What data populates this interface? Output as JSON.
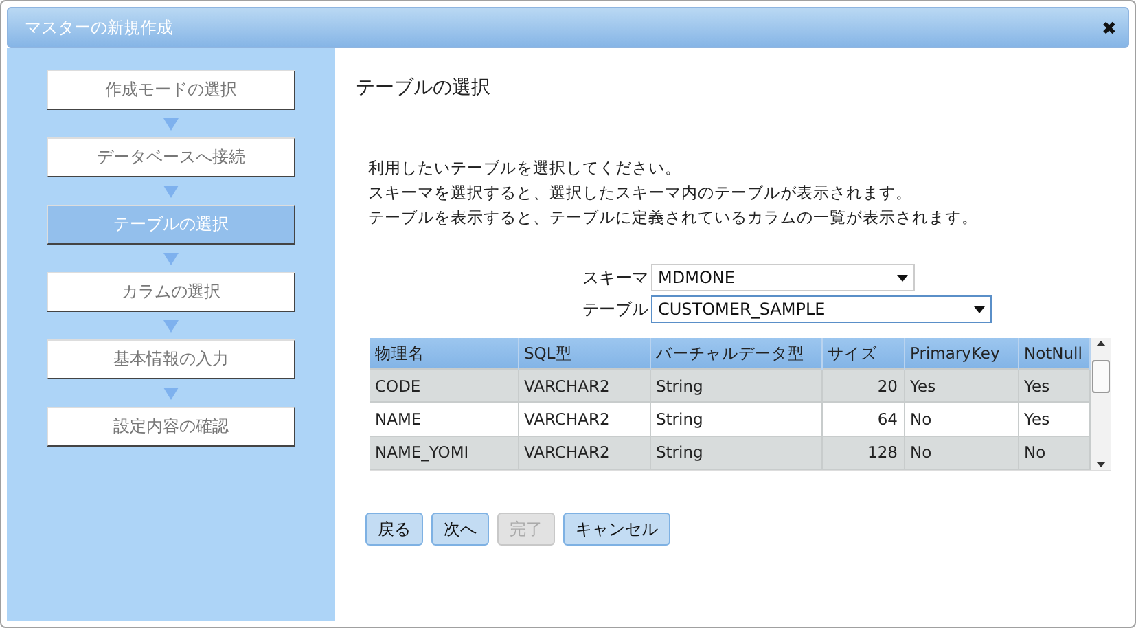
{
  "window": {
    "title": "マスターの新規作成",
    "close": "✖"
  },
  "steps": [
    {
      "label": "作成モードの選択",
      "selected": false
    },
    {
      "label": "データベースへ接続",
      "selected": false
    },
    {
      "label": "テーブルの選択",
      "selected": true
    },
    {
      "label": "カラムの選択",
      "selected": false
    },
    {
      "label": "基本情報の入力",
      "selected": false
    },
    {
      "label": "設定内容の確認",
      "selected": false
    }
  ],
  "heading": "テーブルの選択",
  "instructions": [
    "利用したいテーブルを選択してください。",
    "スキーマを選択すると、選択したスキーマ内のテーブルが表示されます。",
    "テーブルを表示すると、テーブルに定義されているカラムの一覧が表示されます。"
  ],
  "schema": {
    "label": "スキーマ",
    "value": "MDMONE"
  },
  "table_select": {
    "label": "テーブル",
    "value": "CUSTOMER_SAMPLE"
  },
  "table": {
    "columns": [
      "物理名",
      "SQL型",
      "バーチャルデータ型",
      "サイズ",
      "PrimaryKey",
      "NotNull"
    ],
    "rows": [
      [
        "CODE",
        "VARCHAR2",
        "String",
        "20",
        "Yes",
        "Yes"
      ],
      [
        "NAME",
        "VARCHAR2",
        "String",
        "64",
        "No",
        "Yes"
      ],
      [
        "NAME_YOMI",
        "VARCHAR2",
        "String",
        "128",
        "No",
        "No"
      ]
    ]
  },
  "buttons": [
    {
      "label": "戻る",
      "disabled": false
    },
    {
      "label": "次へ",
      "disabled": false
    },
    {
      "label": "完了",
      "disabled": true
    },
    {
      "label": "キャンセル",
      "disabled": false
    }
  ]
}
